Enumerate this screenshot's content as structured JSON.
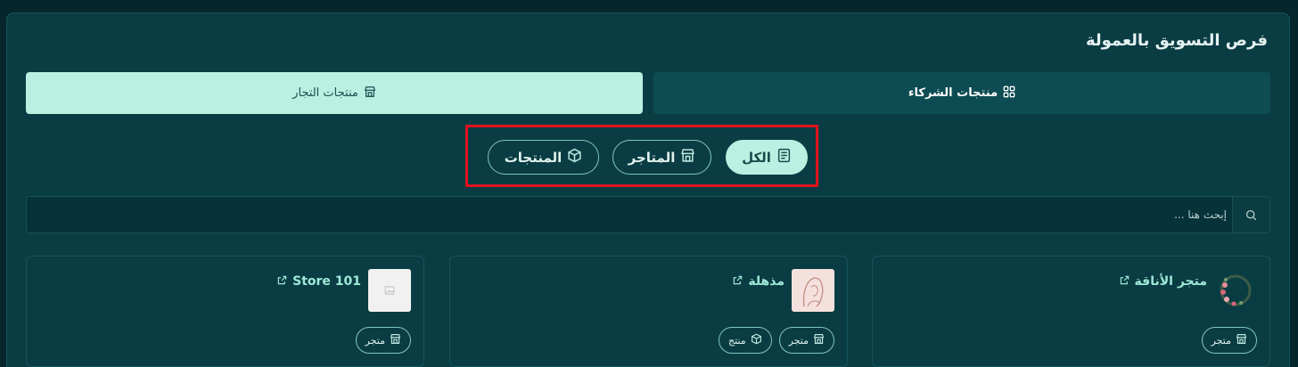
{
  "page": {
    "title": "فرص التسويق بالعمولة"
  },
  "tabs": {
    "partners": {
      "label": "منتجات الشركاء",
      "icon": "grid-icon"
    },
    "merchants": {
      "label": "منتجات التجار",
      "icon": "store-icon"
    }
  },
  "filters": {
    "all": {
      "label": "الكل",
      "icon": "document-icon"
    },
    "stores": {
      "label": "المتاجر",
      "icon": "store-icon"
    },
    "products": {
      "label": "المنتجات",
      "icon": "box-icon"
    }
  },
  "search": {
    "placeholder": "إبحث هنا ..."
  },
  "cards": [
    {
      "name": "متجر الأناقة",
      "thumb": "wreath-image",
      "tags": [
        {
          "label": "متجر",
          "icon": "store-icon"
        }
      ]
    },
    {
      "name": "مذهلة",
      "thumb": "hijab-image",
      "tags": [
        {
          "label": "متجر",
          "icon": "store-icon"
        },
        {
          "label": "منتج",
          "icon": "box-icon"
        }
      ]
    },
    {
      "name": "Store 101",
      "thumb": "placeholder-image",
      "tags": [
        {
          "label": "متجر",
          "icon": "store-icon"
        }
      ]
    }
  ],
  "colors": {
    "accent": "#baf0e2",
    "panel": "#0a3d43",
    "highlight": "#e0131e"
  }
}
